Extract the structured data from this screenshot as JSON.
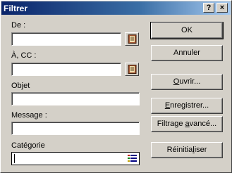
{
  "window": {
    "title": "Filtrer",
    "help_glyph": "?",
    "close_glyph": "×"
  },
  "fields": {
    "de": {
      "label": "De :",
      "value": ""
    },
    "a_cc": {
      "label": "À, CC :",
      "value": ""
    },
    "objet": {
      "label": "Objet",
      "value": ""
    },
    "message": {
      "label": "Message :",
      "value": ""
    },
    "categorie": {
      "label": "Catégorie",
      "value": ""
    }
  },
  "buttons": {
    "ok": {
      "label": "OK"
    },
    "annuler": {
      "label": "Annuler"
    },
    "ouvrir": {
      "pre": "",
      "mnemonic": "O",
      "post": "uvrir..."
    },
    "enregistrer": {
      "pre": "",
      "mnemonic": "E",
      "post": "nregistrer..."
    },
    "filtrage": {
      "pre": "Filtrage ",
      "mnemonic": "a",
      "post": "vancé..."
    },
    "reinitialiser": {
      "pre": "Réinitia",
      "mnemonic": "l",
      "post": "iser"
    }
  },
  "icons": {
    "address_book_1": "address-book-icon",
    "address_book_2": "address-book-icon",
    "category_list": "category-list-icon"
  }
}
